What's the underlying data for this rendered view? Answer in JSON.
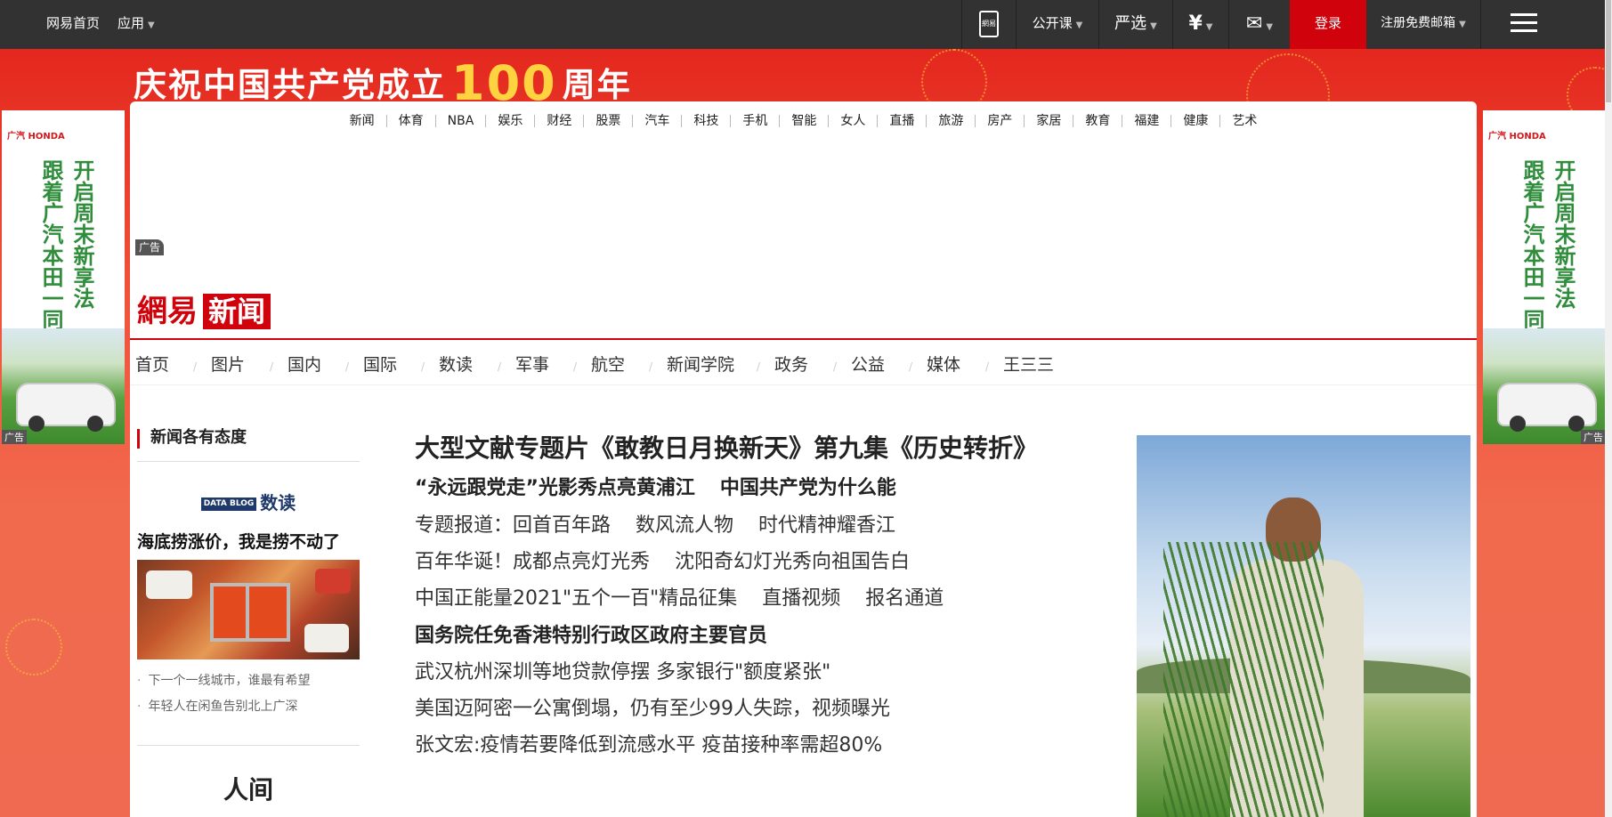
{
  "topbar": {
    "home": "网易首页",
    "apps": "应用",
    "opencourse": "公开课",
    "yanxuan": "严选",
    "pay": "¥",
    "mail": "✉",
    "login": "登录",
    "register": "注册免费邮箱",
    "app_icon_text": "網易"
  },
  "banner": {
    "title_before": "庆祝中国共产党成立",
    "title_number": "100",
    "title_after": "周年"
  },
  "side_ad": {
    "brand": "广汽 HONDA",
    "line1": "开启周末新享法",
    "line2": "跟着广汽本田一同",
    "tag": "广告"
  },
  "channels": [
    "新闻",
    "体育",
    "NBA",
    "娱乐",
    "财经",
    "股票",
    "汽车",
    "科技",
    "手机",
    "智能",
    "女人",
    "直播",
    "旅游",
    "房产",
    "家居",
    "教育",
    "福建",
    "健康",
    "艺术"
  ],
  "ad_label": "广告",
  "logo": {
    "left": "網易",
    "right": "新闻"
  },
  "subnav": [
    "首页",
    "图片",
    "国内",
    "国际",
    "数读",
    "军事",
    "航空",
    "新闻学院",
    "政务",
    "公益",
    "媒体",
    "王三三"
  ],
  "left": {
    "section_title": "新闻各有态度",
    "dataread_box": "DATA BLOG",
    "dataread_label": "数读",
    "lead": "海底捞涨价，我是捞不动了",
    "minis": [
      "下一个一线城市，谁最有希望",
      "年轻人在闲鱼告别北上广深"
    ],
    "renjian": "人间"
  },
  "center": {
    "headline": "大型文献专题片《敢教日月换新天》第九集《历史转折》",
    "lines": [
      {
        "bold": true,
        "items": [
          "“永远跟党走”光影秀点亮黄浦江",
          "中国共产党为什么能"
        ]
      },
      {
        "bold": false,
        "items": [
          "专题报道：回首百年路",
          "数风流人物",
          "时代精神耀香江"
        ]
      },
      {
        "bold": false,
        "items": [
          "百年华诞！成都点亮灯光秀",
          "沈阳奇幻灯光秀向祖国告白"
        ]
      },
      {
        "bold": false,
        "items": [
          "中国正能量2021\"五个一百\"精品征集",
          "直播视频",
          "报名通道"
        ]
      },
      {
        "bold": true,
        "items": [
          "国务院任免香港特别行政区政府主要官员"
        ]
      },
      {
        "bold": false,
        "items": [
          "武汉杭州深圳等地贷款停摆 多家银行\"额度紧张\""
        ]
      },
      {
        "bold": false,
        "items": [
          "美国迈阿密一公寓倒塌，仍有至少99人失踪，视频曝光"
        ]
      },
      {
        "bold": false,
        "items": [
          "张文宏:疫情若要降低到流感水平 疫苗接种率需超80%"
        ]
      }
    ]
  },
  "colors": {
    "accent": "#d0020c",
    "topbar": "#323232",
    "banner": "#e8392a"
  }
}
